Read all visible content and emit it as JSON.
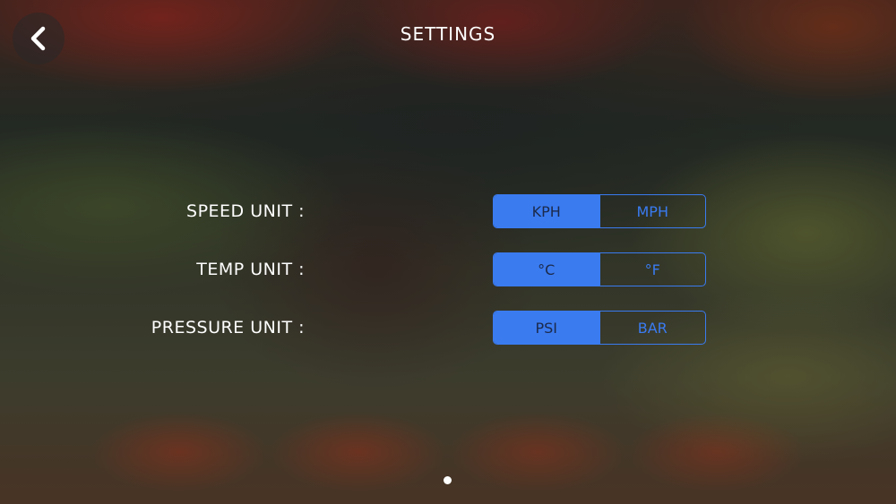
{
  "header": {
    "title": "SETTINGS",
    "back_icon": "chevron-left-icon"
  },
  "settings": [
    {
      "label": "SPEED UNIT :",
      "options": [
        "KPH",
        "MPH"
      ],
      "selected": "KPH"
    },
    {
      "label": "TEMP UNIT :",
      "options": [
        "°C",
        "°F"
      ],
      "selected": "°C"
    },
    {
      "label": "PRESSURE UNIT :",
      "options": [
        "PSI",
        "BAR"
      ],
      "selected": "PSI"
    }
  ],
  "pagination": {
    "current_page": 1,
    "total_pages": 1
  },
  "colors": {
    "accent": "#3a7bf0",
    "text": "#ffffff"
  }
}
